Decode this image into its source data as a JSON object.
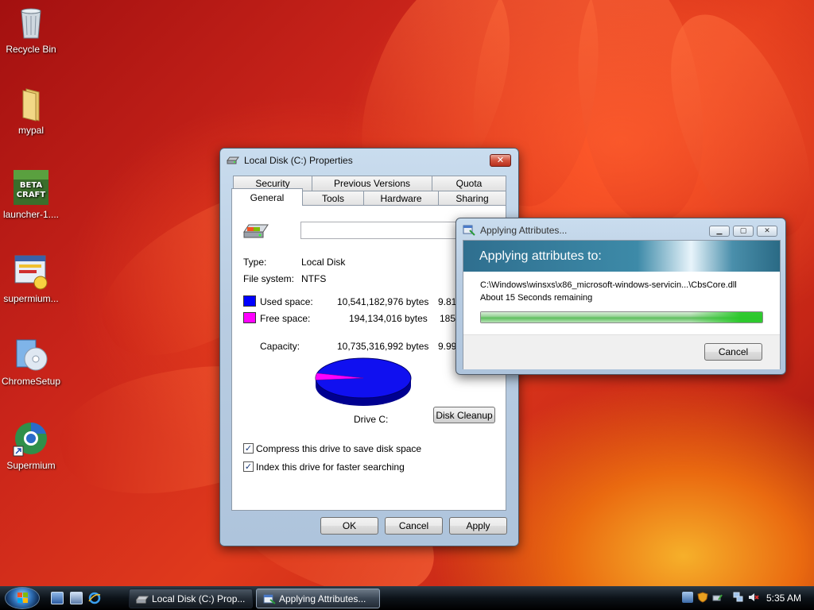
{
  "desktop": {
    "icons": [
      {
        "label": "Recycle Bin",
        "icon": "recycle-bin-icon"
      },
      {
        "label": "mypal",
        "icon": "folder-icon"
      },
      {
        "label": "launcher-1....",
        "icon": "betacraft-icon"
      },
      {
        "label": "supermium...",
        "icon": "installer-icon"
      },
      {
        "label": "ChromeSetup",
        "icon": "setup-disc-icon"
      },
      {
        "label": "Supermium",
        "icon": "supermium-browser-icon"
      }
    ]
  },
  "properties_dialog": {
    "title": "Local Disk (C:) Properties",
    "tabs_row1": [
      "Security",
      "Previous Versions",
      "Quota"
    ],
    "tabs_row2": [
      "General",
      "Tools",
      "Hardware",
      "Sharing"
    ],
    "active_tab": "General",
    "volume_label_value": "",
    "type_label": "Type:",
    "type_value": "Local Disk",
    "fs_label": "File system:",
    "fs_value": "NTFS",
    "used_label": "Used space:",
    "used_bytes": "10,541,182,976 bytes",
    "used_size": "9.81",
    "free_label": "Free space:",
    "free_bytes": "194,134,016 bytes",
    "free_size": "185",
    "capacity_label": "Capacity:",
    "capacity_bytes": "10,735,316,992 bytes",
    "capacity_size": "9.99",
    "drive_label": "Drive C:",
    "disk_cleanup_label": "Disk Cleanup",
    "compress_label": "Compress this drive to save disk space",
    "compress_checked": true,
    "index_label": "Index this drive for faster searching",
    "index_checked": true,
    "ok_label": "OK",
    "cancel_label": "Cancel",
    "apply_label": "Apply",
    "colors": {
      "used": "#0000ff",
      "free": "#ff00ff"
    },
    "pie": {
      "used_fraction": 0.982,
      "free_fraction": 0.018
    }
  },
  "attributes_dialog": {
    "title": "Applying Attributes...",
    "header": "Applying attributes to:",
    "path": "C:\\Windows\\winsxs\\x86_microsoft-windows-servicin...\\CbsCore.dll",
    "remaining": "About 15 Seconds remaining",
    "progress": 1.0,
    "cancel_label": "Cancel"
  },
  "taskbar": {
    "tasks": [
      {
        "label": "Local Disk (C:) Prop...",
        "icon": "drive-icon",
        "active": false
      },
      {
        "label": "Applying Attributes...",
        "icon": "attributes-icon",
        "active": true
      }
    ],
    "clock": "5:35 AM"
  }
}
